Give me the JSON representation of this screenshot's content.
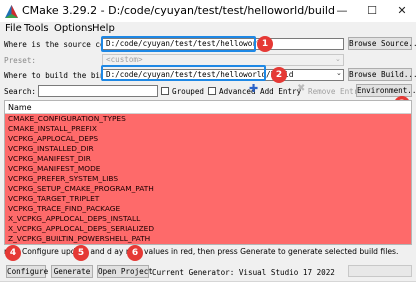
{
  "window": {
    "title": "CMake 3.29.2 - D:/code/cyuyan/test/test/helloworld/build",
    "minimize": "—",
    "maximize": "☐",
    "close": "✕"
  },
  "menu": {
    "file": "File",
    "tools": "Tools",
    "options": "Options",
    "help": "Help"
  },
  "form": {
    "source_label": "Where is the source code:",
    "source_value": "D:/code/cyuyan/test/test/helloworld",
    "browse_source": "Browse Source...",
    "preset_label": "Preset:",
    "preset_value": "<custom>",
    "build_label": "Where to build the binaries:",
    "build_value": "D:/code/cyuyan/test/test/helloworld/build",
    "browse_build": "Browse Build...",
    "search_label": "Search:",
    "search_value": "",
    "grouped_label": "Grouped",
    "grouped_checked": false,
    "advanced_label": "Advanced",
    "advanced_checked": false,
    "add_entry": "Add Entry",
    "remove_entry": "Remove Entry",
    "environment": "Environment..."
  },
  "table": {
    "column_header": "Name",
    "row_color": "#fe6a6a",
    "rows": [
      "CMAKE_CONFIGURATION_TYPES",
      "CMAKE_INSTALL_PREFIX",
      "VCPKG_APPLOCAL_DEPS",
      "VCPKG_INSTALLED_DIR",
      "VCPKG_MANIFEST_DIR",
      "VCPKG_MANIFEST_MODE",
      "VCPKG_PREFER_SYSTEM_LIBS",
      "VCPKG_SETUP_CMAKE_PROGRAM_PATH",
      "VCPKG_TARGET_TRIPLET",
      "VCPKG_TRACE_FIND_PACKAGE",
      "X_VCPKG_APPLOCAL_DEPS_INSTALL",
      "X_VCPKG_APPLOCAL_DEPS_SERIALIZED",
      "Z_VCPKG_BUILTIN_POWERSHELL_PATH"
    ]
  },
  "status_text": "ress Configure   update and d   ay new values in red, then press Generate to generate selected build files.",
  "actions": {
    "configure": "Configure",
    "generate": "Generate",
    "open_project": "Open Project",
    "generator_text": "Current Generator: Visual Studio 17 2022"
  },
  "annotations": [
    "1",
    "2",
    "3",
    "4",
    "5",
    "6"
  ],
  "colors": {
    "highlight": "#1e88e5",
    "badge": "#e53935"
  }
}
